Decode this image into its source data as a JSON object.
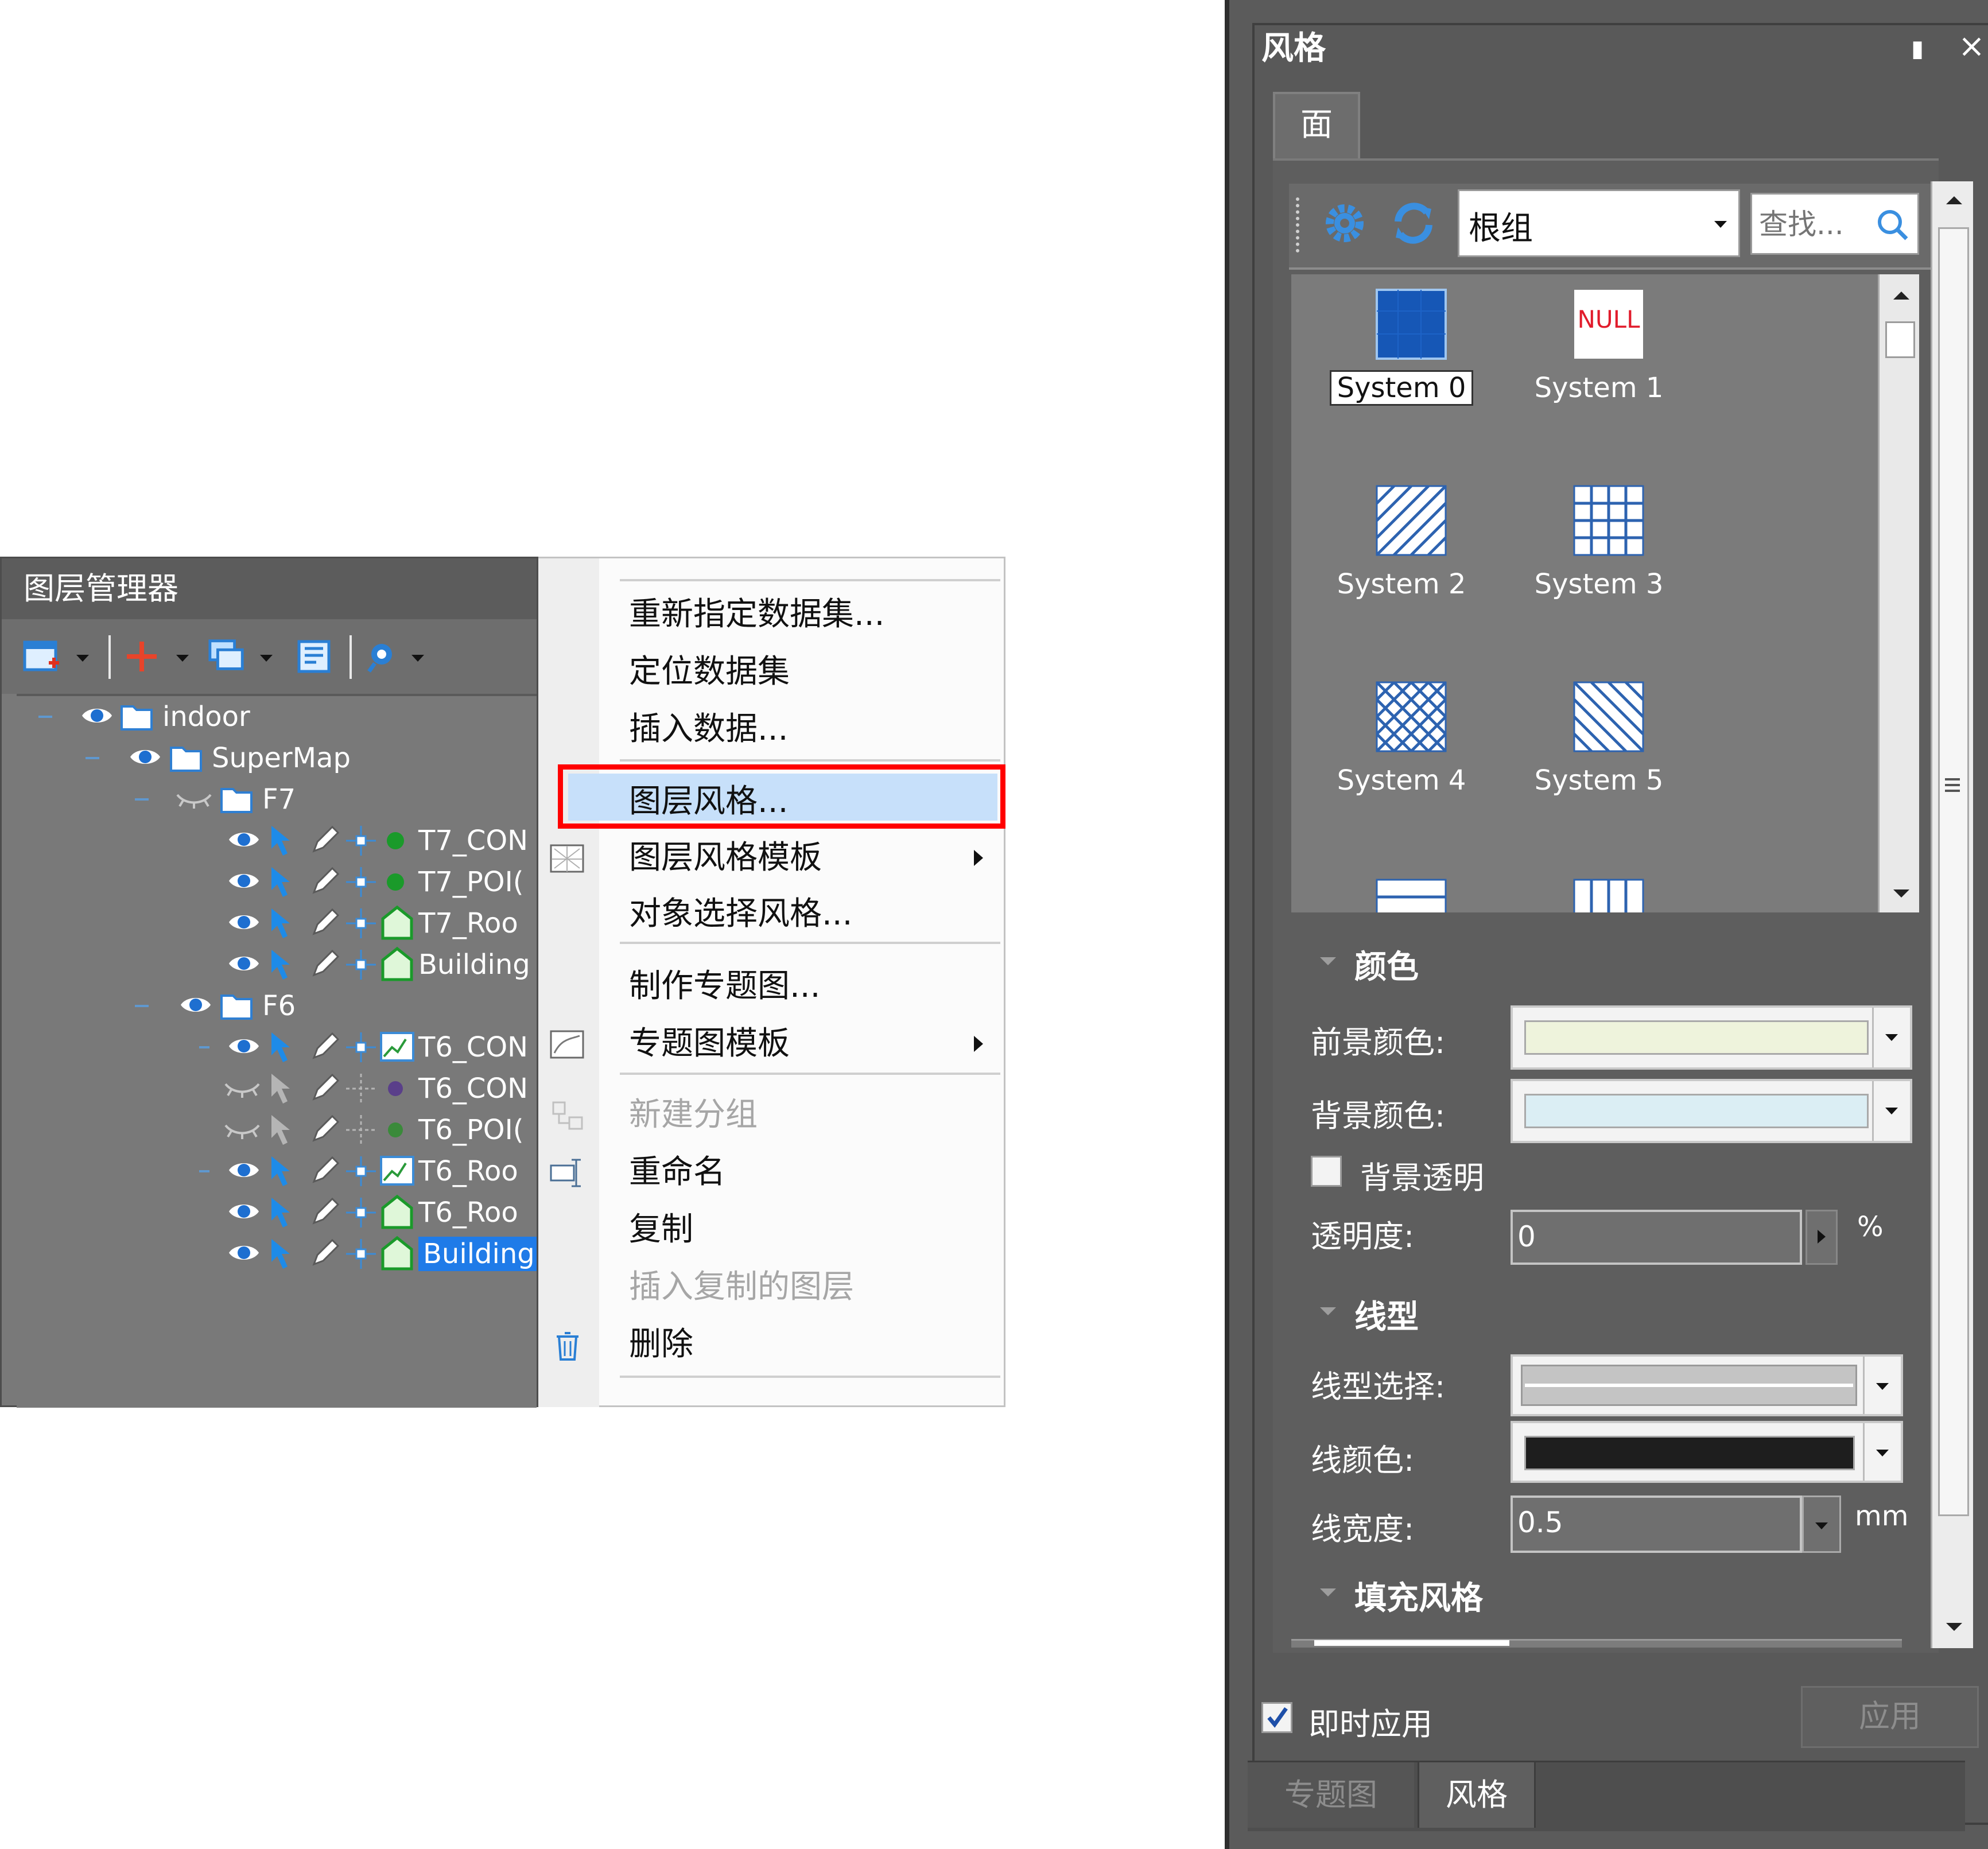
{
  "layer_manager": {
    "title": "图层管理器",
    "tree": [
      {
        "label": "indoor",
        "level": 0
      },
      {
        "label": "SuperMap",
        "level": 1
      },
      {
        "label": "F7",
        "level": 2
      },
      {
        "label": "T7_CON",
        "level": 3
      },
      {
        "label": "T7_POI(",
        "level": 3
      },
      {
        "label": "T7_Roo",
        "level": 3
      },
      {
        "label": "Building",
        "level": 3
      },
      {
        "label": "F6",
        "level": 2
      },
      {
        "label": "T6_CON",
        "level": 3
      },
      {
        "label": "T6_CON",
        "level": 3
      },
      {
        "label": "T6_POI(",
        "level": 3
      },
      {
        "label": "T6_Roo",
        "level": 3
      },
      {
        "label": "T6_Roo",
        "level": 3
      },
      {
        "label": "Building",
        "level": 3
      }
    ]
  },
  "context_menu": {
    "items": [
      {
        "label": "重新指定数据集..."
      },
      {
        "label": "定位数据集"
      },
      {
        "label": "插入数据..."
      },
      {
        "label": "图层风格..."
      },
      {
        "label": "图层风格模板"
      },
      {
        "label": "对象选择风格..."
      },
      {
        "label": "制作专题图..."
      },
      {
        "label": "专题图模板"
      },
      {
        "label": "新建分组"
      },
      {
        "label": "重命名"
      },
      {
        "label": "复制"
      },
      {
        "label": "插入复制的图层"
      },
      {
        "label": "删除"
      }
    ],
    "highlight_color": "#ff0000"
  },
  "style_panel": {
    "title": "风格",
    "tab": "面",
    "root_group": "根组",
    "search_placeholder": "查找...",
    "symbols": [
      "System 0",
      "System 1",
      "System 2",
      "System 3",
      "System 4",
      "System 5"
    ],
    "null_text": "NULL",
    "color_section": "颜色",
    "fg_label": "前景颜色:",
    "fg_color": "#eef3dc",
    "bg_label": "背景颜色:",
    "bg_color": "#dbeef4",
    "bg_transparent": "背景透明",
    "transparency_label": "透明度:",
    "transparency_value": "0",
    "percent": "%",
    "line_section": "线型",
    "line_type_label": "线型选择:",
    "line_color_label": "线颜色:",
    "line_color": "#1e1e1e",
    "line_width_label": "线宽度:",
    "line_width_value": "0.5",
    "mm": "mm",
    "fill_section": "填充风格",
    "instant_apply": "即时应用",
    "apply": "应用",
    "bottom_tabs": [
      "专题图",
      "风格"
    ]
  }
}
